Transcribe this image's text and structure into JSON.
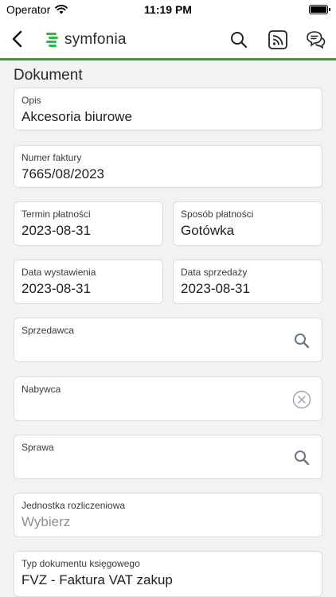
{
  "status_bar": {
    "carrier": "Operator",
    "time": "11:19 PM",
    "icons": [
      "wifi-icon",
      "battery-icon"
    ]
  },
  "nav": {
    "logo_text": "symfonia",
    "icons": [
      "back-icon",
      "search-icon",
      "feed-icon",
      "chat-icon"
    ],
    "accent_color": "#2fa33a"
  },
  "section": {
    "title": "Dokument"
  },
  "fields": {
    "opis": {
      "label": "Opis",
      "value": "Akcesoria biurowe"
    },
    "numer_faktury": {
      "label": "Numer faktury",
      "value": "7665/08/2023"
    },
    "termin_platnosci": {
      "label": "Termin płatności",
      "value": "2023-08-31"
    },
    "sposob_platnosci": {
      "label": "Sposób płatności",
      "value": "Gotówka"
    },
    "data_wystawienia": {
      "label": "Data wystawienia",
      "value": "2023-08-31"
    },
    "data_sprzedazy": {
      "label": "Data sprzedaży",
      "value": "2023-08-31"
    },
    "sprzedawca": {
      "label": "Sprzedawca",
      "value": "",
      "icon": "search-icon"
    },
    "nabywca": {
      "label": "Nabywca",
      "value": "",
      "icon": "clear-icon"
    },
    "sprawa": {
      "label": "Sprawa",
      "value": "",
      "icon": "search-icon"
    },
    "jednostka": {
      "label": "Jednostka rozliczeniowa",
      "placeholder": "Wybierz"
    },
    "typ_dokumentu": {
      "label": "Typ dokumentu księgowego",
      "value": "FVZ - Faktura VAT zakup"
    }
  }
}
